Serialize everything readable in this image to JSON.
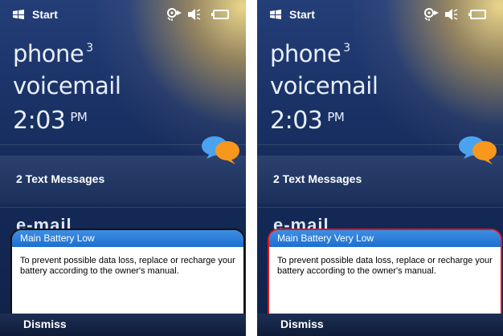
{
  "screens": [
    {
      "status": {
        "start_label": "Start",
        "icons": [
          "connectivity-icon",
          "speaker-muted-icon",
          "battery-icon"
        ]
      },
      "home": {
        "phone_label": "phone",
        "phone_count": "3",
        "voicemail_label": "voicemail",
        "time": "2:03",
        "ampm": "PM",
        "text_messages": "2 Text Messages",
        "email_peek": "e-mail"
      },
      "popup": {
        "title": "Main Battery Low",
        "body": "To prevent possible data loss, replace or recharge your battery according to the owner's manual.",
        "border_color": "#101010"
      },
      "softkey": {
        "dismiss_label": "Dismiss"
      }
    },
    {
      "status": {
        "start_label": "Start",
        "icons": [
          "connectivity-icon",
          "speaker-muted-icon",
          "battery-icon"
        ]
      },
      "home": {
        "phone_label": "phone",
        "phone_count": "3",
        "voicemail_label": "voicemail",
        "time": "2:03",
        "ampm": "PM",
        "text_messages": "2 Text Messages",
        "email_peek": "e-mail"
      },
      "popup": {
        "title": "Main Battery Very Low",
        "body": "To prevent possible data loss, replace or recharge your battery according to the owner's manual.",
        "border_color": "#e0141e"
      },
      "softkey": {
        "dismiss_label": "Dismiss"
      }
    }
  ],
  "colors": {
    "popup_title_bg": "#1d6fcf",
    "warning_border": "#e0141e"
  }
}
